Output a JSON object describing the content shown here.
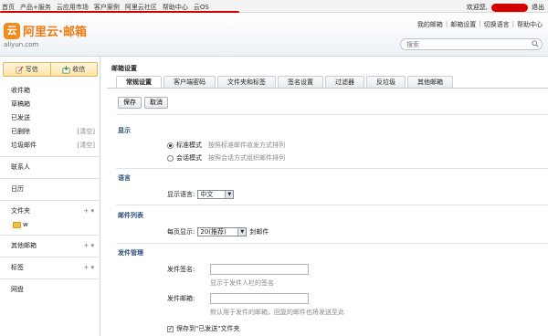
{
  "topbar": {
    "nav": [
      "首页",
      "产品+服务",
      "云应用市场",
      "客户案例",
      "阿里云社区",
      "帮助中心",
      "云OS"
    ],
    "welcome": "欢迎您,",
    "logout": "退出"
  },
  "header": {
    "logo_mark": "云",
    "logo_text": "阿里云·邮箱",
    "logo_sub": "aliyun.com",
    "links": [
      "我的邮箱",
      "邮箱设置",
      "切换语言",
      "帮助中心"
    ],
    "search_placeholder": "搜索"
  },
  "sidebar": {
    "compose_label": "写信",
    "inbox_label": "收信",
    "folders": [
      {
        "label": "收件箱",
        "clear": ""
      },
      {
        "label": "草稿箱",
        "clear": ""
      },
      {
        "label": "已发送",
        "clear": ""
      },
      {
        "label": "已删除",
        "clear": "[清空]"
      },
      {
        "label": "垃圾邮件",
        "clear": "[清空]"
      }
    ],
    "contacts": "联系人",
    "calendar": "日历",
    "folder_group": "文件夹",
    "folder_controls": "+ ▾",
    "subfolder": "w",
    "other_mail": "其他邮箱",
    "tags": "标签",
    "netdisk": "网盘"
  },
  "main": {
    "title": "邮箱设置",
    "tabs": [
      "常规设置",
      "客户端密码",
      "文件夹和标签",
      "签名设置",
      "过滤器",
      "反垃圾",
      "其他邮箱"
    ],
    "save": "保存",
    "cancel": "取消",
    "display": {
      "title": "显示",
      "standard_label": "标准模式",
      "standard_desc": "按照标准邮件收发方式排列",
      "conversation_label": "会话模式",
      "conversation_desc": "按照会话方式组织邮件排列"
    },
    "language": {
      "title": "语言",
      "label": "显示语言:",
      "value": "中文"
    },
    "mail_list": {
      "title": "邮件列表",
      "label": "每页显示:",
      "value": "20(推荐)",
      "suffix": "封邮件"
    },
    "sending": {
      "title": "发件管理",
      "name_label": "发件签名:",
      "name_hint": "显示于发件人栏的签名",
      "reply_label": "发件邮箱:",
      "reply_hint": "默认用于发件的邮箱，回复的邮件也将发送至此",
      "save_sent": "保存到\"已发送\"文件夹"
    }
  },
  "colors": {
    "accent_orange": "#f07b12",
    "red_mark": "#d40000"
  }
}
